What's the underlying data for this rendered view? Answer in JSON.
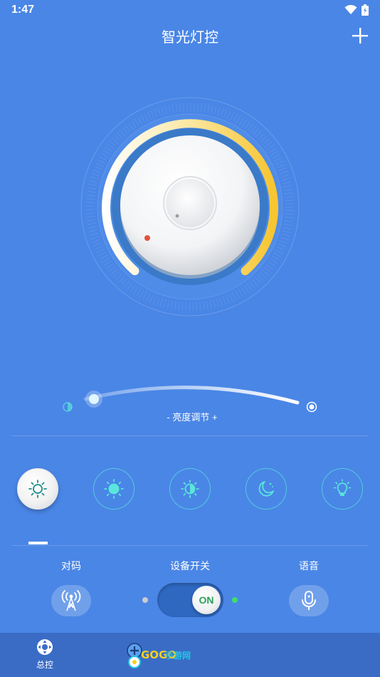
{
  "status": {
    "time": "1:47"
  },
  "header": {
    "title": "智光灯控"
  },
  "brightness": {
    "label": "- 亮度调节 +",
    "level": 0.03
  },
  "modes": [
    {
      "icon": "sun-outline-icon",
      "active": true
    },
    {
      "icon": "sun-bright-icon",
      "active": false
    },
    {
      "icon": "sun-dim-icon",
      "active": false
    },
    {
      "icon": "moon-icon",
      "active": false
    },
    {
      "icon": "bulb-icon",
      "active": false
    }
  ],
  "controls": {
    "pair_label": "对码",
    "power_label": "设备开关",
    "voice_label": "语音",
    "power_state": "ON"
  },
  "nav": {
    "items": [
      {
        "label": "总控"
      }
    ]
  },
  "watermark": {
    "brand": "GOGO",
    "suffix": "手游网"
  },
  "colors": {
    "background": "#4a86e6",
    "accent_yellow": "#f7c531",
    "teal": "#5ae6dc",
    "on_green": "#2e9e5a"
  }
}
